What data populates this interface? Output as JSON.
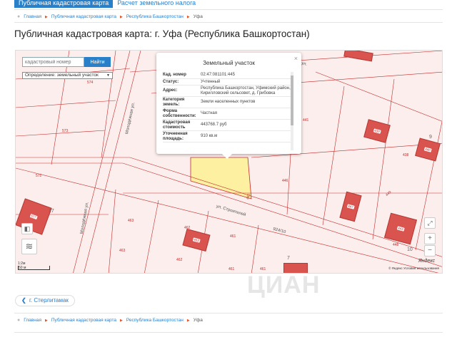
{
  "tabs": [
    {
      "label": "Публичная кадастровая карта",
      "active": true
    },
    {
      "label": "Расчет земельного налога",
      "active": false
    }
  ],
  "breadcrumbs": [
    "Главная",
    "Публичная кадастровая карта",
    "Республика Башкортостан",
    "Уфа"
  ],
  "page_title": "Публичная кадастровая карта: г. Уфа (Республика Башкортостан)",
  "map": {
    "search": {
      "placeholder": "кадастровый номер",
      "button": "Найти"
    },
    "select_value": "Определение: земельный участок",
    "popup": {
      "title": "Земельный участок",
      "close": "×",
      "rows": [
        {
          "key": "Кад. номер",
          "value": "02:47:081101:445"
        },
        {
          "key": "Статус:",
          "value": "Учтенный"
        },
        {
          "key": "Адрес:",
          "value": "Республика Башкортостан, Уфимский район, Кирилловский сельсовет, д. Грибовка"
        },
        {
          "key": "Категория земель:",
          "value": "Земли населенных пунктов"
        },
        {
          "key": "Форма собственности:",
          "value": "Частная"
        },
        {
          "key": "Кадастровая стоимость",
          "value": "443768.7 руб"
        },
        {
          "key": "Уточненная площадь:",
          "value": "910 кв.м"
        }
      ]
    },
    "plots": [
      "574",
      "573",
      "572",
      "577",
      "463",
      "462",
      "461",
      "463",
      "462",
      "461",
      "446",
      "447",
      "449",
      "443",
      "448",
      "441",
      "439",
      "438",
      "440",
      "445",
      "7",
      "9",
      "10",
      "17"
    ],
    "streets": [
      "Молодёжная ул.",
      "Молодёжная ул.",
      "ул. Строителей",
      "ул.",
      "924/10"
    ],
    "zoom_in": "+",
    "zoom_out": "−",
    "scale_label": "50 м",
    "scale_label_top": "1:2м",
    "yandex": "Яндекс",
    "copyright": "© Яндекс  Условия использования"
  },
  "back_link": "г. Стерлитамак",
  "watermark": "ЦИАН",
  "colors": {
    "accent": "#2a7fc9",
    "plot_line": "#c62a2a",
    "selected_plot": "#fdf0a0"
  }
}
